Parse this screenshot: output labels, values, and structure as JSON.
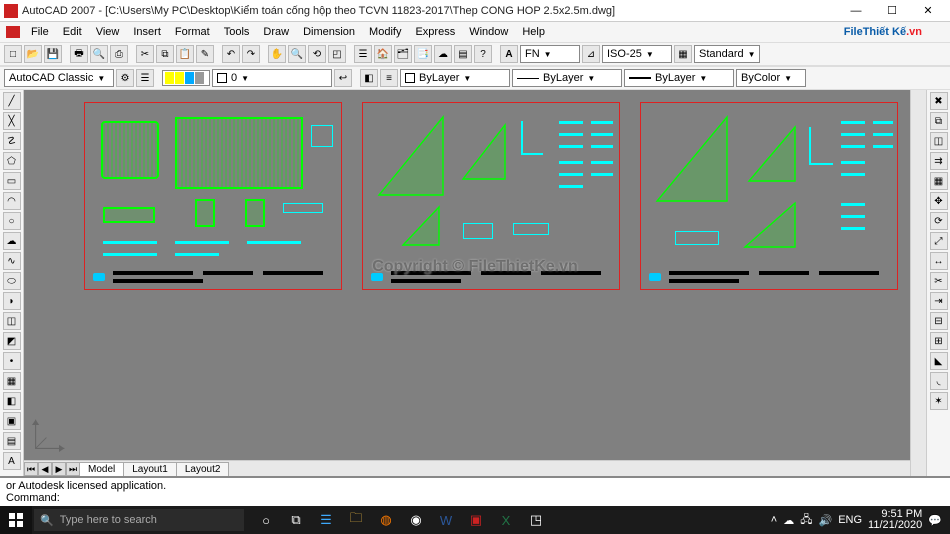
{
  "titlebar": {
    "text": "AutoCAD 2007 - [C:\\Users\\My PC\\Desktop\\Kiểm toán cống hộp theo TCVN 11823-2017\\Thep CONG HOP 2.5x2.5m.dwg]"
  },
  "menus": {
    "file": "File",
    "edit": "Edit",
    "view": "View",
    "insert": "Insert",
    "format": "Format",
    "tools": "Tools",
    "draw": "Draw",
    "dimension": "Dimension",
    "modify": "Modify",
    "express": "Express",
    "window": "Window",
    "help": "Help"
  },
  "toolbar1": {
    "style_a": "A",
    "font": "FN",
    "dimstyle": "ISO-25",
    "std": "Standard"
  },
  "toolbar2": {
    "workspace": "AutoCAD Classic",
    "layer": "0",
    "linetype": "ByLayer",
    "lineweight": "ByLayer",
    "plotstyle": "ByLayer",
    "color": "ByColor"
  },
  "layout_tabs": {
    "model": "Model",
    "l1": "Layout1",
    "l2": "Layout2"
  },
  "command_lines": {
    "line1": "or Autodesk licensed application.",
    "line2": "Command:"
  },
  "watermark": {
    "logo_left": "File",
    "logo_right": "Thiết Kế",
    "logo_ext": ".vn",
    "center": "Copyright © FileThietKe.vn"
  },
  "taskbar": {
    "search_placeholder": "Type here to search",
    "lang": "ENG",
    "time": "9:51 PM",
    "date": "11/21/2020"
  }
}
